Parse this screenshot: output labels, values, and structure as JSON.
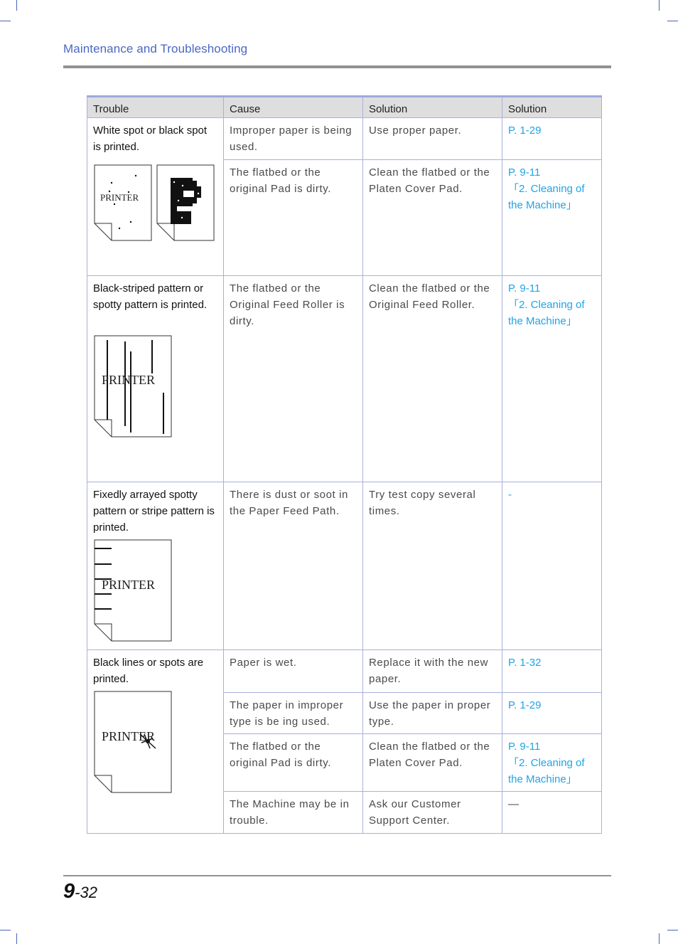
{
  "header": {
    "section_title": "Maintenance and Troubleshooting"
  },
  "table": {
    "columns": [
      "Trouble",
      "Cause",
      "Solution",
      "Solution"
    ],
    "groups": [
      {
        "trouble": "White spot or black spot is printed.",
        "illustration": "white-black-spot-illustration",
        "rows": [
          {
            "cause": "Improper paper is being used.",
            "solution": "Use proper paper.",
            "reference": [
              "P. 1-29"
            ]
          },
          {
            "cause": "The flatbed or the original Pad is dirty.",
            "solution": "Clean the flatbed or the Platen Cover Pad.",
            "reference": [
              "P. 9-11",
              "「2. Cleaning of",
              "the Machine」"
            ]
          }
        ]
      },
      {
        "trouble": "Black-striped pattern or spotty pattern is printed.",
        "illustration": "striped-pattern-illustration",
        "rows": [
          {
            "cause": "The flatbed or the Original Feed Roller is dirty.",
            "solution": "Clean the flatbed or the Original Feed Roller.",
            "reference": [
              "P. 9-11",
              "「2. Cleaning of",
              "the Machine」"
            ]
          }
        ]
      },
      {
        "trouble": "Fixedly arrayed spotty pattern or stripe pattern is printed.",
        "illustration": "arrayed-stripe-illustration",
        "rows": [
          {
            "cause": "There is dust or soot in the Paper Feed Path.",
            "solution": "Try test copy several times.",
            "reference": [
              "-"
            ]
          }
        ]
      },
      {
        "trouble": "Black lines or spots are printed.",
        "illustration": "black-lines-spots-illustration",
        "rows": [
          {
            "cause": "Paper is wet.",
            "solution": "Replace it with the new paper.",
            "reference": [
              "P. 1-32"
            ]
          },
          {
            "cause": "The paper in improper type is be ing used.",
            "solution": "Use the paper in proper type.",
            "reference": [
              "P. 1-29"
            ]
          },
          {
            "cause": "The flatbed or the original Pad is dirty.",
            "solution": "Clean the flatbed or the Platen Cover Pad.",
            "reference": [
              "P. 9-11",
              "「2. Cleaning of",
              "the Machine」"
            ]
          },
          {
            "cause": "The Machine may be in trouble.",
            "solution": "Ask our Customer Support Center.",
            "reference": [
              "—"
            ]
          }
        ]
      }
    ],
    "illustration_text": "PRINTER"
  },
  "footer": {
    "chapter": "9",
    "page": "-32"
  },
  "colors": {
    "header_text": "#4a67c4",
    "link": "#1ea4e6",
    "table_border": "#a9b0dd",
    "header_fill": "#dedede"
  }
}
